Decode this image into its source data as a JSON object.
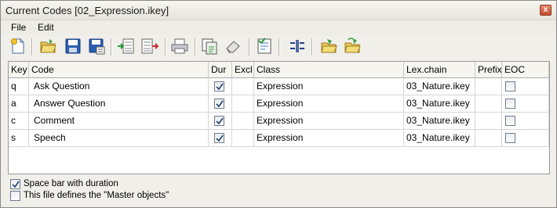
{
  "window": {
    "title": "Current Codes [02_Expression.ikey]",
    "close_glyph": "x"
  },
  "menu": {
    "items": [
      {
        "label": "File"
      },
      {
        "label": "Edit"
      }
    ]
  },
  "toolbar": {
    "buttons": [
      {
        "icon": "new-file-icon"
      },
      {
        "icon": "open-folder-icon"
      },
      {
        "icon": "save-icon"
      },
      {
        "icon": "save-as-icon"
      },
      {
        "icon": "import-icon"
      },
      {
        "icon": "export-icon"
      },
      {
        "icon": "print-icon"
      },
      {
        "icon": "copy-icon"
      },
      {
        "icon": "eraser-icon"
      },
      {
        "icon": "document-check-icon"
      },
      {
        "icon": "columns-icon"
      },
      {
        "icon": "folder-edit-icon"
      },
      {
        "icon": "folder-refresh-icon"
      }
    ]
  },
  "grid": {
    "columns": [
      "Key",
      "Code",
      "Dur",
      "Excl",
      "Class",
      "Lex.chain",
      "Prefix",
      "EOC"
    ],
    "rows": [
      {
        "key": "q",
        "code": "Ask Question",
        "dur": true,
        "excl": "",
        "class": "Expression",
        "lex": "03_Nature.ikey",
        "prefix": "",
        "eoc": false
      },
      {
        "key": "a",
        "code": "Answer Question",
        "dur": true,
        "excl": "",
        "class": "Expression",
        "lex": "03_Nature.ikey",
        "prefix": "",
        "eoc": false
      },
      {
        "key": "c",
        "code": "Comment",
        "dur": true,
        "excl": "",
        "class": "Expression",
        "lex": "03_Nature.ikey",
        "prefix": "",
        "eoc": false
      },
      {
        "key": "s",
        "code": "Speech",
        "dur": true,
        "excl": "",
        "class": "Expression",
        "lex": "03_Nature.ikey",
        "prefix": "",
        "eoc": false
      }
    ]
  },
  "options": {
    "space_bar": {
      "label": "Space bar with duration",
      "checked": true
    },
    "master": {
      "label": "This file defines the \"Master objects\"",
      "checked": false
    }
  },
  "colors": {
    "accent_blue": "#1f5fbf",
    "check_mark": "#2b4a7a"
  }
}
